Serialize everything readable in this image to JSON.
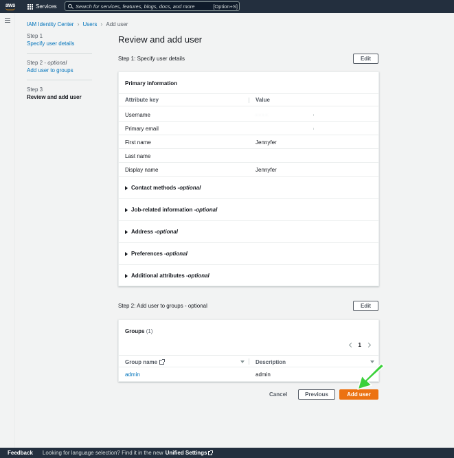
{
  "topbar": {
    "logo": "aws",
    "services_label": "Services",
    "search_placeholder": "Search for services, features, blogs, docs, and more",
    "search_shortcut": "[Option+S]"
  },
  "breadcrumb": {
    "items": [
      "IAM Identity Center",
      "Users",
      "Add user"
    ]
  },
  "steps": [
    {
      "num": "Step 1",
      "optional": "",
      "label": "Specify user details"
    },
    {
      "num": "Step 2 - ",
      "optional": "optional",
      "label": "Add user to groups"
    },
    {
      "num": "Step 3",
      "optional": "",
      "label": "Review and add user"
    }
  ],
  "page_title": "Review and add user",
  "step1": {
    "heading": "Step 1: Specify user details",
    "edit_label": "Edit",
    "panel_title": "Primary information",
    "col_key": "Attribute key",
    "col_value": "Value",
    "rows": [
      {
        "key": "Username",
        "value": "·  ·  ·  ·"
      },
      {
        "key": "Primary email",
        "value": ""
      },
      {
        "key": "First name",
        "value": "Jennyfer"
      },
      {
        "key": "Last name",
        "value": ""
      },
      {
        "key": "Display name",
        "value": "Jennyfer"
      }
    ],
    "expanders": [
      {
        "label": "Contact methods - ",
        "opt": "optional"
      },
      {
        "label": "Job-related information - ",
        "opt": "optional"
      },
      {
        "label": "Address - ",
        "opt": "optional"
      },
      {
        "label": "Preferences - ",
        "opt": "optional"
      },
      {
        "label": "Additional attributes - ",
        "opt": "optional"
      }
    ]
  },
  "step2": {
    "heading": "Step 2: Add user to groups - optional",
    "edit_label": "Edit",
    "groups_title": "Groups",
    "groups_count": "(1)",
    "page": "1",
    "col_group": "Group name",
    "col_desc": "Description",
    "rows": [
      {
        "name": "admin",
        "description": "admin"
      }
    ]
  },
  "actions": {
    "cancel": "Cancel",
    "previous": "Previous",
    "submit": "Add user"
  },
  "footer": {
    "feedback": "Feedback",
    "language_text": "Looking for language selection? Find it in the new",
    "unified": "Unified Settings"
  },
  "colors": {
    "nav_bg": "#232f3e",
    "link": "#0073bb",
    "primary": "#ec7211",
    "arrow": "#3bd13b"
  }
}
